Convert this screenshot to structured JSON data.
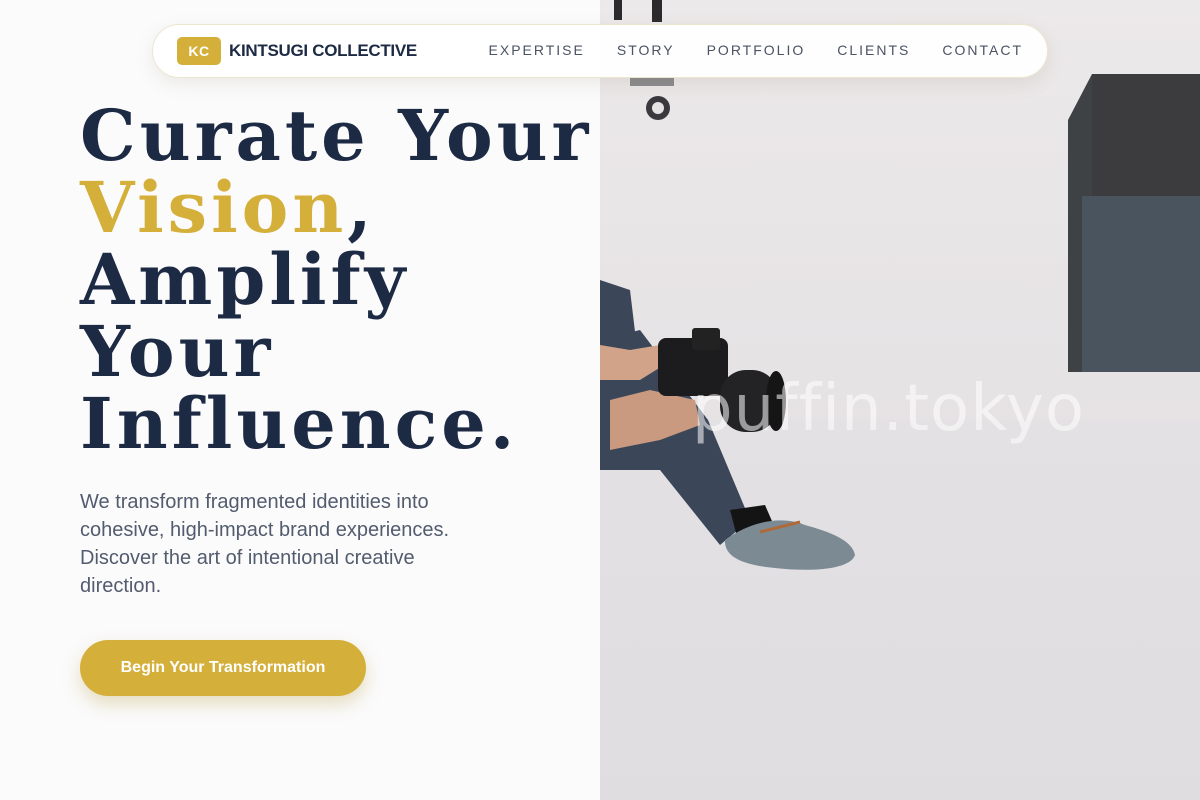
{
  "nav": {
    "logo_badge": "KC",
    "brand": "KINTSUGI COLLECTIVE",
    "links": [
      "EXPERTISE",
      "STORY",
      "PORTFOLIO",
      "CLIENTS",
      "CONTACT"
    ]
  },
  "hero": {
    "headline_1": "Curate Your",
    "headline_accent": "Vision",
    "headline_comma": ",",
    "headline_3": "Amplify",
    "headline_4": "Your",
    "headline_5": "Influence.",
    "subtext": "We transform fragmented identities into cohesive, high-impact brand experiences. Discover the art of intentional creative direction.",
    "cta_label": "Begin Your Transformation"
  },
  "photo": {
    "watermark": "puffin.tokyo",
    "subject": "photographer-with-camera-sitting-on-floor"
  },
  "colors": {
    "accent": "#d4b03a",
    "navy": "#1d2a44",
    "body_text": "#525c6e"
  }
}
